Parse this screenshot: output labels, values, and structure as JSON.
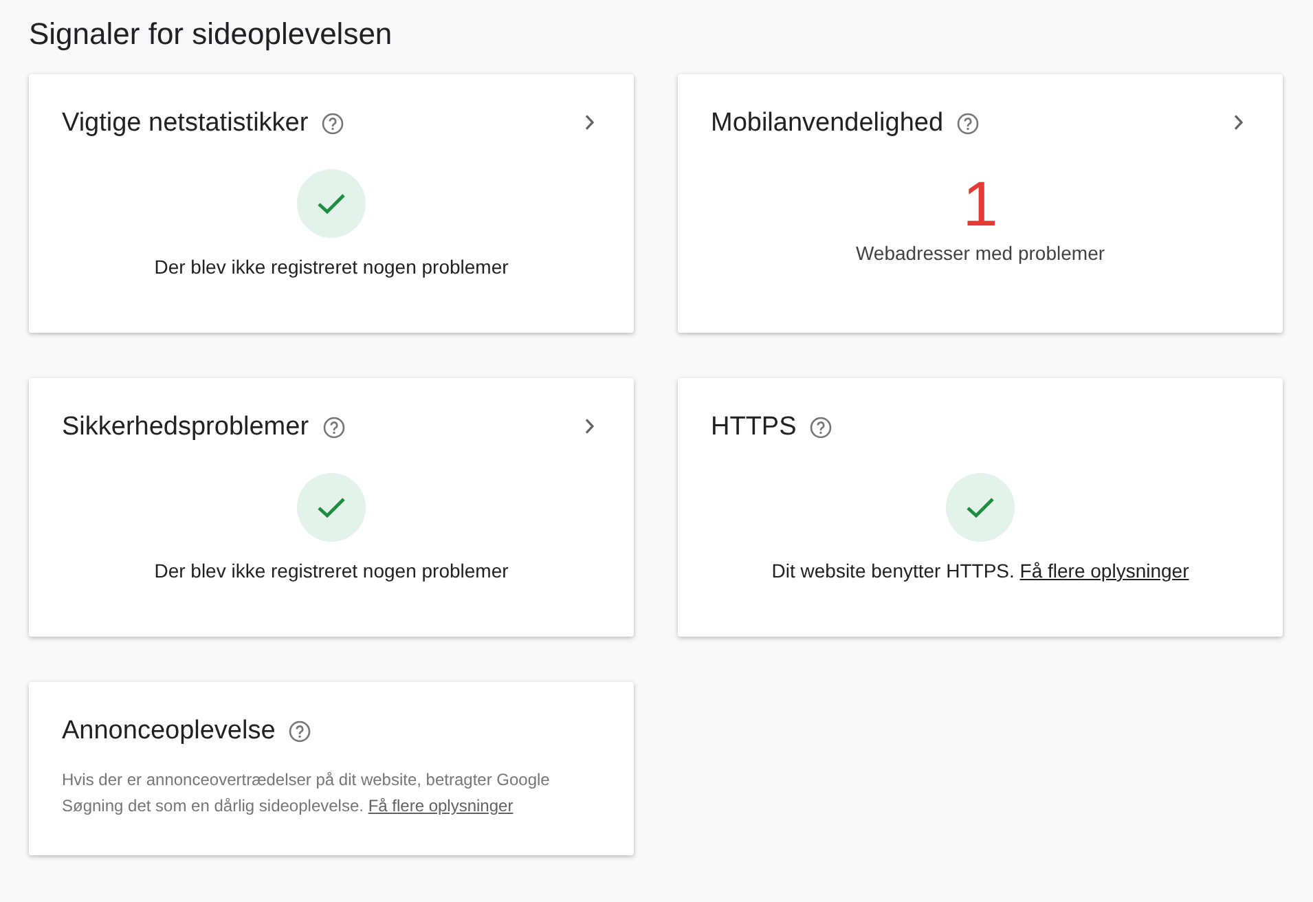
{
  "page_title": "Signaler for sideoplevelsen",
  "cards": [
    {
      "title": "Vigtige netstatistikker",
      "chevron": true,
      "kind": "ok",
      "text": "Der blev ikke registreret nogen problemer"
    },
    {
      "title": "Mobilanvendelighed",
      "chevron": true,
      "kind": "count",
      "count": "1",
      "text": "Webadresser med problemer"
    },
    {
      "title": "Sikkerhedsproblemer",
      "chevron": true,
      "kind": "ok",
      "text": "Der blev ikke registreret nogen problemer"
    },
    {
      "title": "HTTPS",
      "chevron": false,
      "kind": "ok",
      "text": "Dit website benytter HTTPS.",
      "link": "Få flere oplysninger"
    },
    {
      "title": "Annonceoplevelse",
      "chevron": false,
      "kind": "description",
      "text": "Hvis der er annonceovertrædelser på dit website, betragter Google Søgning det som en dårlig sideoplevelse.",
      "link": "Få flere oplysninger"
    }
  ]
}
